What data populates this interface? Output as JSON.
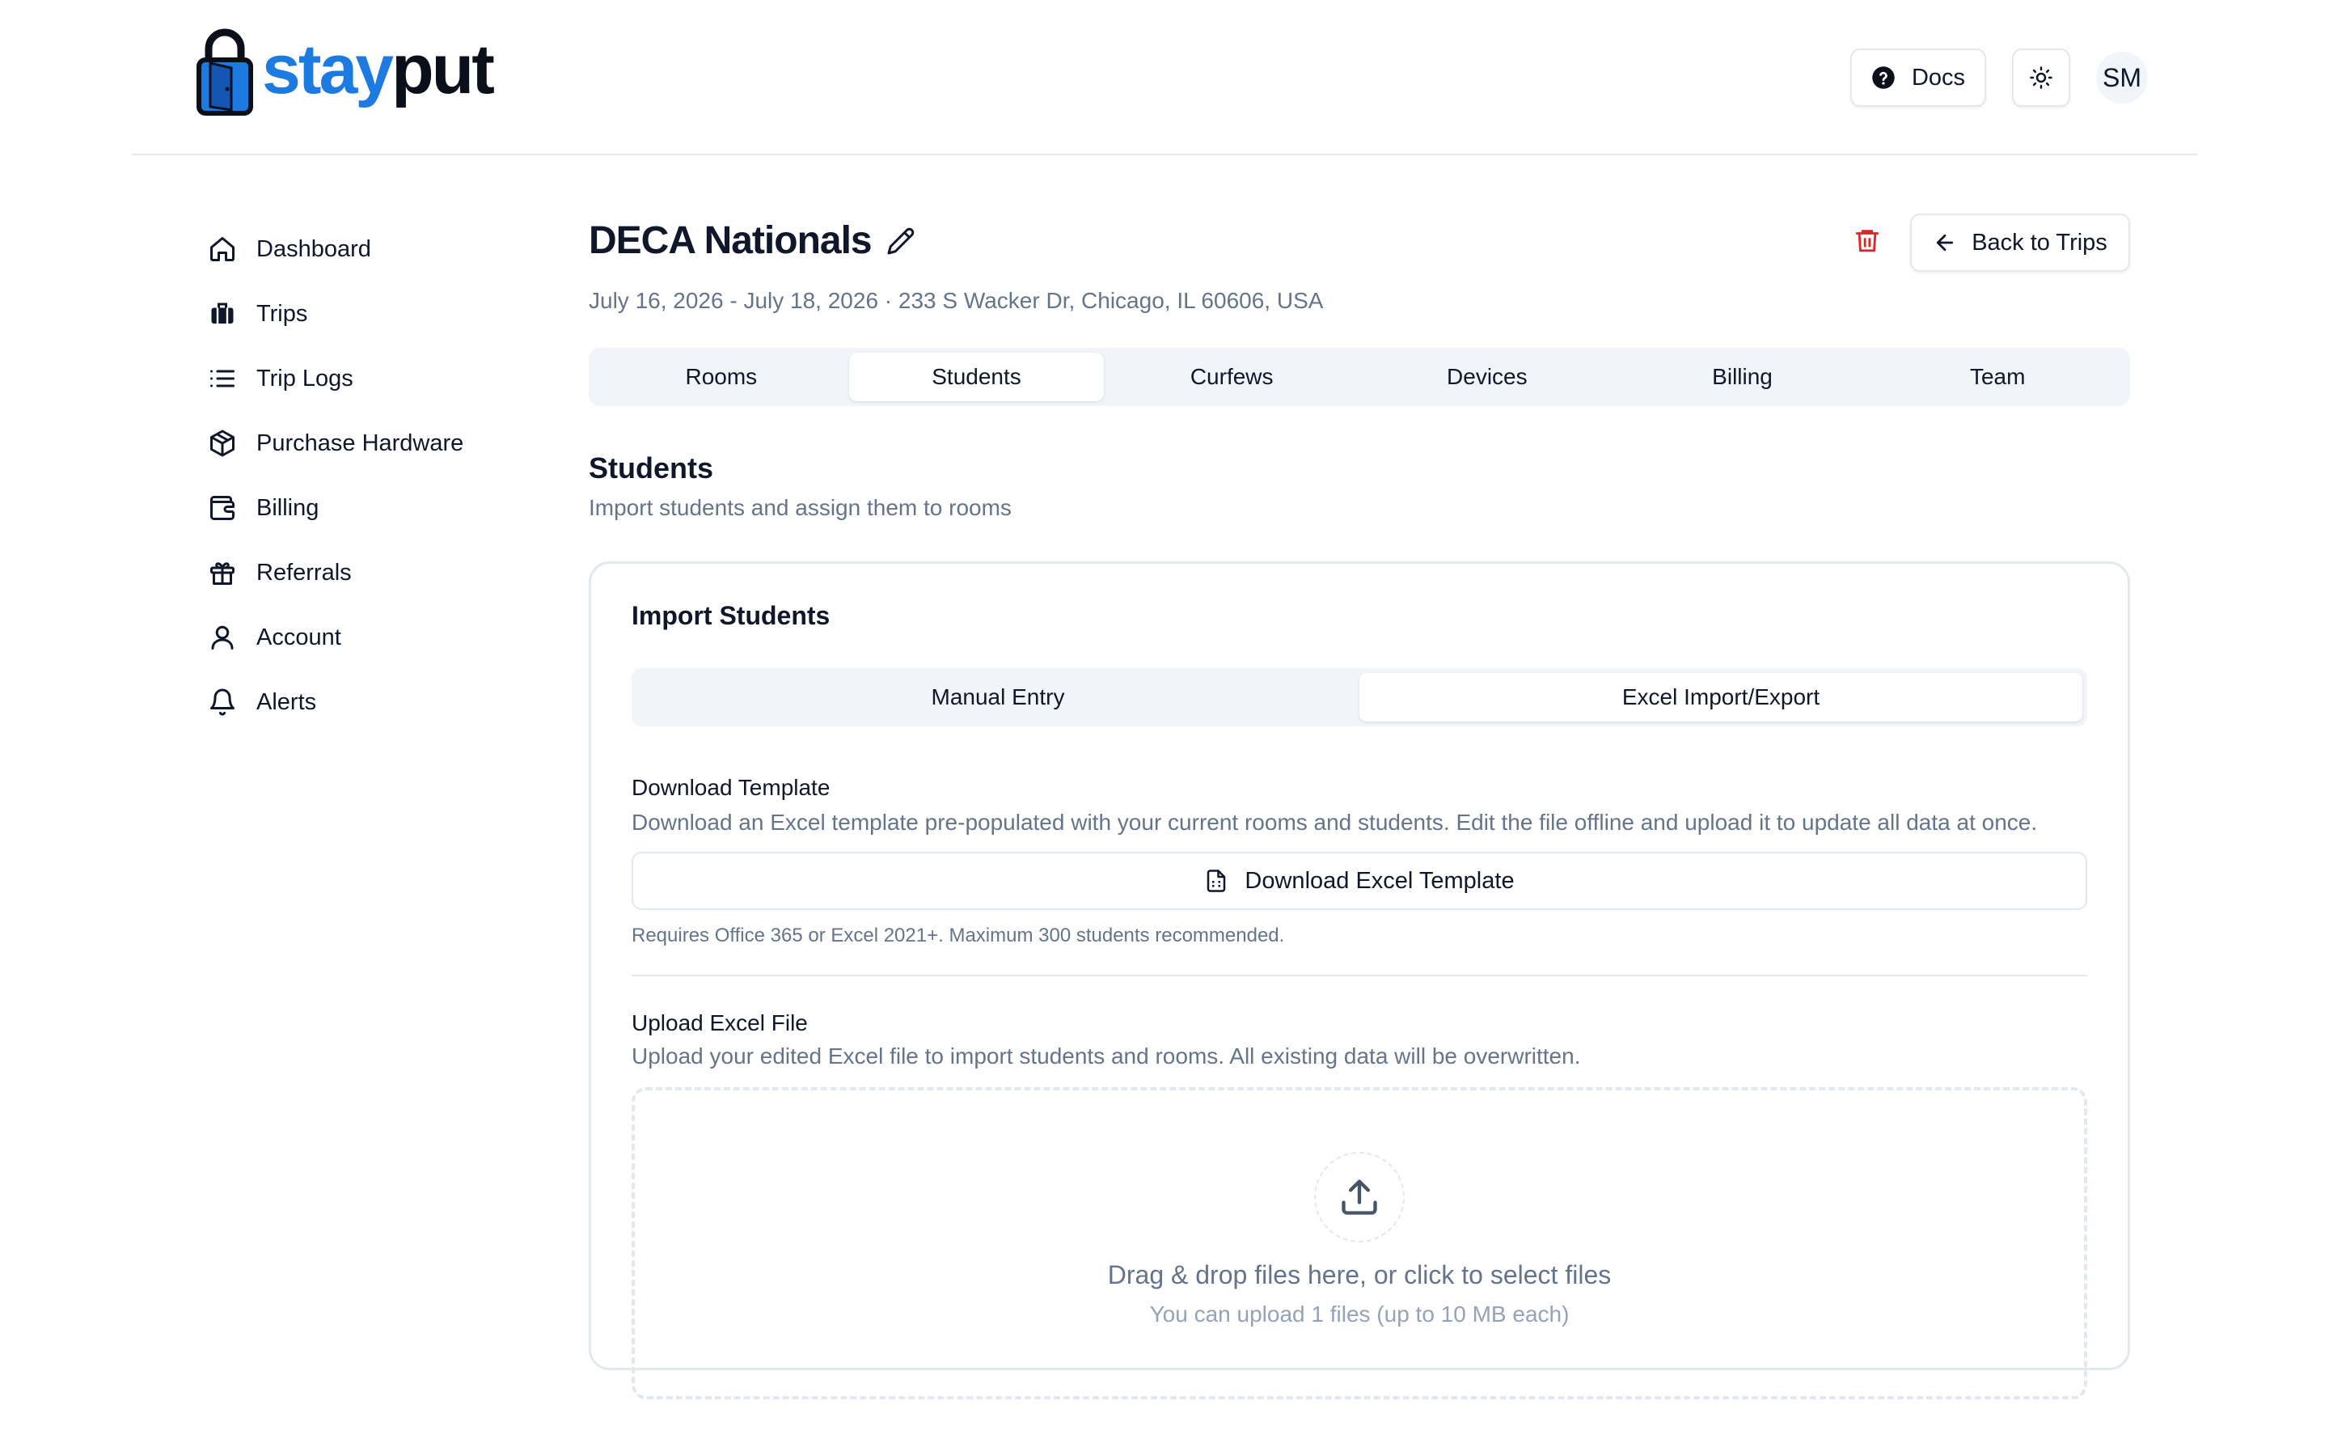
{
  "brand": {
    "part1": "stay",
    "part2": "put"
  },
  "header": {
    "docs_label": "Docs",
    "avatar_initials": "SM"
  },
  "sidebar": {
    "items": [
      {
        "label": "Dashboard",
        "icon": "home-icon"
      },
      {
        "label": "Trips",
        "icon": "luggage-icon"
      },
      {
        "label": "Trip Logs",
        "icon": "list-icon"
      },
      {
        "label": "Purchase Hardware",
        "icon": "package-icon"
      },
      {
        "label": "Billing",
        "icon": "wallet-icon"
      },
      {
        "label": "Referrals",
        "icon": "gift-icon"
      },
      {
        "label": "Account",
        "icon": "user-icon"
      },
      {
        "label": "Alerts",
        "icon": "bell-icon"
      }
    ]
  },
  "trip": {
    "title": "DECA Nationals",
    "subline": "July 16, 2026 - July 18, 2026 · 233 S Wacker Dr, Chicago, IL 60606, USA",
    "back_label": "Back to Trips"
  },
  "tabs": {
    "items": [
      "Rooms",
      "Students",
      "Curfews",
      "Devices",
      "Billing",
      "Team"
    ],
    "active": "Students"
  },
  "section": {
    "title": "Students",
    "description": "Import students and assign them to rooms"
  },
  "import_card": {
    "title": "Import Students",
    "subtabs": [
      "Manual Entry",
      "Excel Import/Export"
    ],
    "active_subtab": "Excel Import/Export",
    "download": {
      "title": "Download Template",
      "description": "Download an Excel template pre-populated with your current rooms and students. Edit the file offline and upload it to update all data at once.",
      "button_label": "Download Excel Template",
      "hint": "Requires Office 365 or Excel 2021+. Maximum 300 students recommended."
    },
    "upload": {
      "title": "Upload Excel File",
      "description": "Upload your edited Excel file to import students and rooms. All existing data will be overwritten.",
      "drop_main": "Drag & drop files here, or click to select files",
      "drop_sub": "You can upload 1 files (up to 10 MB each)"
    }
  },
  "colors": {
    "brand_blue": "#1d7ae0",
    "text": "#0f172a",
    "muted": "#64748b",
    "danger": "#dc2626",
    "tab_bg": "#f1f5f9"
  }
}
